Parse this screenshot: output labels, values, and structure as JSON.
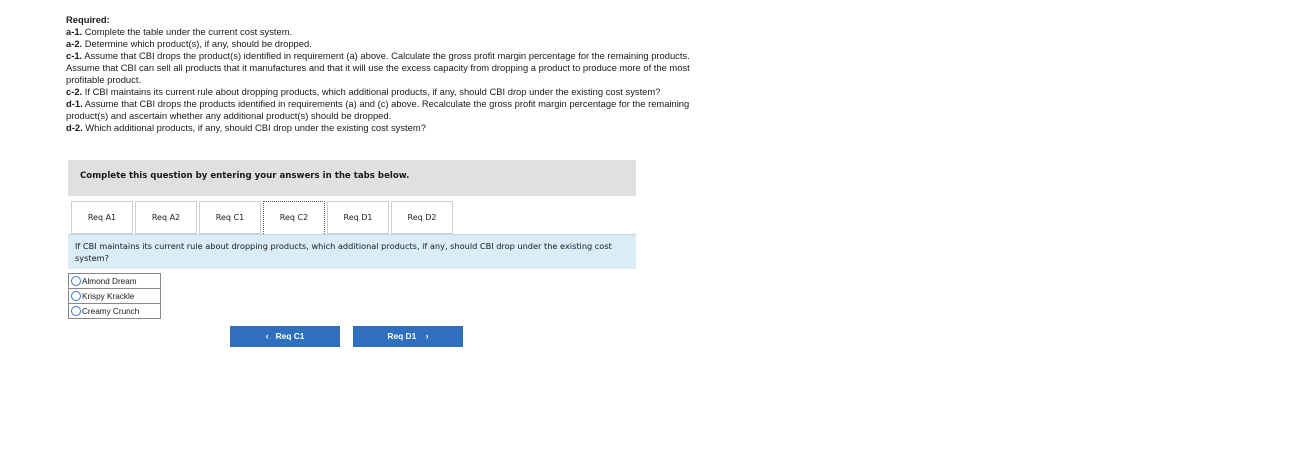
{
  "requirements": {
    "heading": "Required:",
    "items": [
      {
        "label": "a-1.",
        "text": " Complete the table under the current cost system."
      },
      {
        "label": "a-2.",
        "text": " Determine which product(s), if any, should be dropped."
      },
      {
        "label": "c-1.",
        "text": " Assume that CBI drops the product(s) identified in requirement (a) above. Calculate the gross profit margin percentage for the remaining products. Assume that CBI can sell all products that it manufactures and that it will use the excess capacity from dropping a product to produce more of the most profitable product."
      },
      {
        "label": "c-2.",
        "text": " If CBI maintains its current rule about dropping products, which additional products, if any, should CBI drop under the existing cost system?"
      },
      {
        "label": "d-1.",
        "text": " Assume that CBI drops the products identified in requirements (a) and (c) above. Recalculate the gross profit margin percentage for the remaining product(s) and ascertain whether any additional product(s) should be dropped."
      },
      {
        "label": "d-2.",
        "text": " Which additional products, if any, should CBI drop under the existing cost system?"
      }
    ]
  },
  "instruction": "Complete this question by entering your answers in the tabs below.",
  "tabs": [
    {
      "label": "Req A1"
    },
    {
      "label": "Req A2"
    },
    {
      "label": "Req C1"
    },
    {
      "label": "Req C2"
    },
    {
      "label": "Req D1"
    },
    {
      "label": "Req D2"
    }
  ],
  "question": "If CBI maintains its current rule about dropping products, which additional products, if any, should CBI drop under the existing cost system?",
  "options": [
    {
      "label": "Almond Dream"
    },
    {
      "label": "Krispy Krackle"
    },
    {
      "label": "Creamy Crunch"
    }
  ],
  "nav": {
    "prev_label": "Req C1",
    "prev_chevron": "‹",
    "next_label": "Req D1",
    "next_chevron": "›"
  },
  "colors": {
    "accent": "#2f6fbe",
    "question_bg": "#d9ecf8",
    "instruction_bg": "#e0e0e0"
  }
}
